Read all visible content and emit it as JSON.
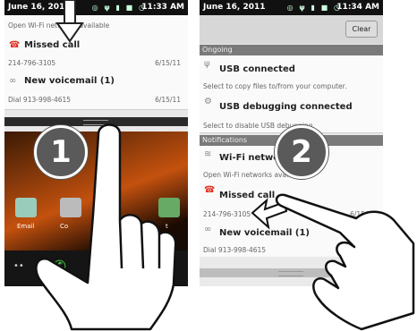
{
  "step1": {
    "number": "1",
    "statusbar": {
      "date": "June 16, 2011",
      "time": "11:33 AM"
    },
    "partial_sub": "Open Wi-Fi networks available",
    "notifications": [
      {
        "title": "Missed call",
        "sub": "214-796-3105",
        "date": "6/15/11",
        "icon": "missed-call-icon"
      },
      {
        "title": "New voicemail (1)",
        "sub": "Dial 913-998-4615",
        "date": "6/15/11",
        "icon": "voicemail-icon"
      }
    ],
    "apps": [
      "Email",
      "Co",
      "t"
    ]
  },
  "step2": {
    "number": "2",
    "statusbar": {
      "date": "June 16, 2011",
      "time": "11:34 AM"
    },
    "clear_label": "Clear",
    "sections": {
      "ongoing": "Ongoing",
      "notifications": "Notifications"
    },
    "ongoing": [
      {
        "title": "USB connected",
        "sub": "Select to copy files to/from your computer.",
        "icon": "usb-icon"
      },
      {
        "title": "USB debugging connected",
        "sub": "Select to disable USB debugging.",
        "icon": "debug-icon"
      }
    ],
    "notifications": [
      {
        "title": "Wi-Fi networks",
        "sub": "Open Wi-Fi networks available",
        "date": "",
        "icon": "wifi-icon"
      },
      {
        "title": "Missed call",
        "sub": "214-796-3105",
        "date": "6/15/11",
        "icon": "missed-call-icon"
      },
      {
        "title": "New voicemail (1)",
        "sub": "Dial 913-998-4615",
        "date": "",
        "icon": "voicemail-icon"
      }
    ]
  },
  "colors": {
    "missed": "#e03020",
    "accent": "#c4510e",
    "section_bar": "#7a7a7a"
  }
}
